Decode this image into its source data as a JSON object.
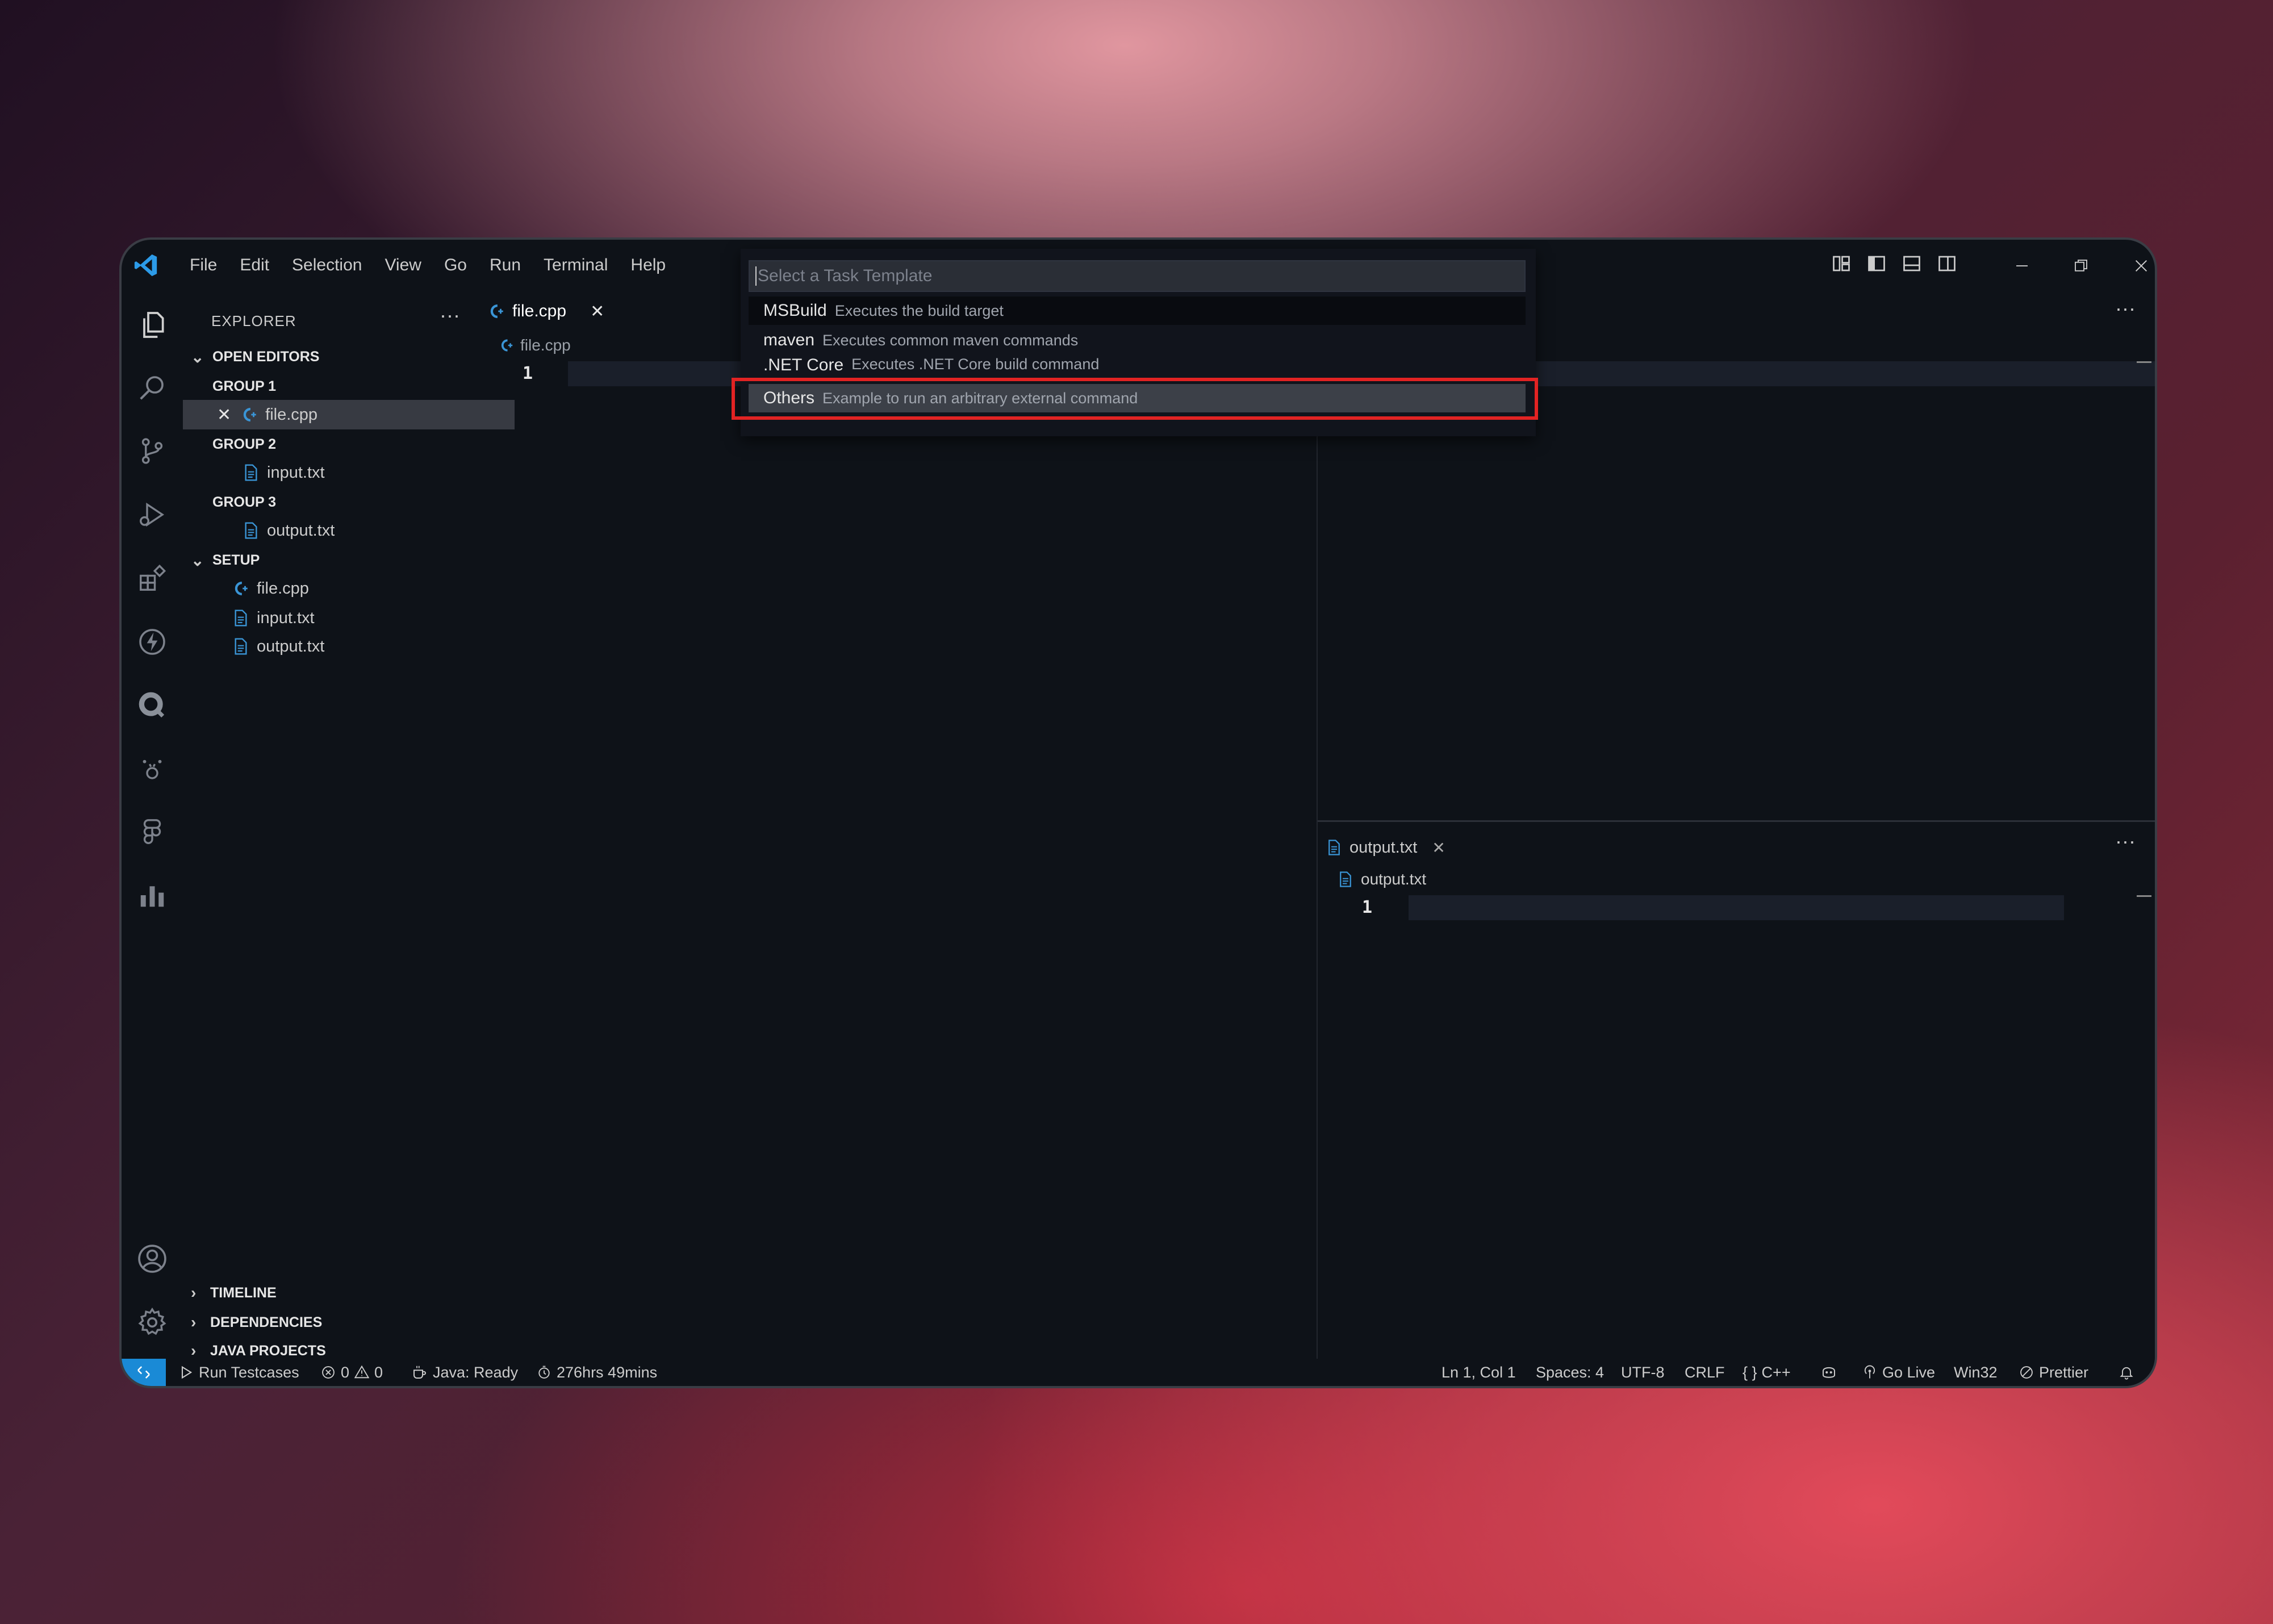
{
  "menu": [
    "File",
    "Edit",
    "Selection",
    "View",
    "Go",
    "Run",
    "Terminal",
    "Help"
  ],
  "quickpick": {
    "placeholder": "Select a Task Template",
    "items": [
      {
        "label": "MSBuild",
        "description": "Executes the build target"
      },
      {
        "label": "maven",
        "description": "Executes common maven commands"
      },
      {
        "label": ".NET Core",
        "description": "Executes .NET Core build command"
      },
      {
        "label": "Others",
        "description": "Example to run an arbitrary external command"
      }
    ]
  },
  "sidebar": {
    "title": "EXPLORER",
    "open_editors": "OPEN EDITORS",
    "group1": "GROUP 1",
    "group1_file": "file.cpp",
    "group2": "GROUP 2",
    "group2_file": "input.txt",
    "group3": "GROUP 3",
    "group3_file": "output.txt",
    "setup": "SETUP",
    "setup_files": [
      "file.cpp",
      "input.txt",
      "output.txt"
    ],
    "timeline": "TIMELINE",
    "dependencies": "DEPENDENCIES",
    "java_projects": "JAVA PROJECTS"
  },
  "editor_left": {
    "tab": "file.cpp",
    "breadcrumb": "file.cpp",
    "line": "1"
  },
  "editor_right_bottom": {
    "tab": "output.txt",
    "breadcrumb": "output.txt",
    "line": "1"
  },
  "statusbar": {
    "run_testcases": "Run Testcases",
    "errors": "0",
    "warnings": "0",
    "java": "Java: Ready",
    "time": "276hrs 49mins",
    "position": "Ln 1, Col 1",
    "spaces": "Spaces: 4",
    "encoding": "UTF-8",
    "eol": "CRLF",
    "language": "C++",
    "golive": "Go Live",
    "platform": "Win32",
    "prettier": "Prettier"
  },
  "colors": {
    "accent": "#1a8ad6",
    "highlight": "#e22323",
    "editor_bg": "#0e1218"
  }
}
